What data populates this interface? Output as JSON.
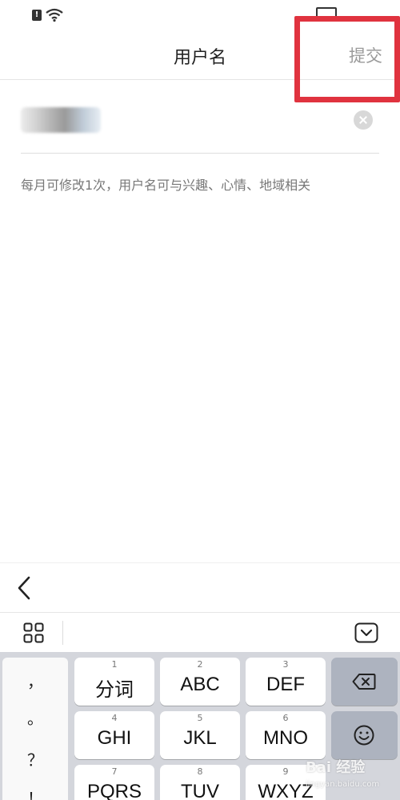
{
  "status_bar": {
    "sim_alert": "!",
    "battery": "",
    "time": ""
  },
  "nav": {
    "title": "用户名",
    "submit_label": "提交"
  },
  "form": {
    "username_value": "",
    "hint": "每月可修改1次，用户名可与兴趣、心情、地域相关"
  },
  "keyboard": {
    "punctuation": [
      "，",
      "。",
      "？",
      "！"
    ],
    "keys": [
      {
        "num": "1",
        "label": "分词"
      },
      {
        "num": "2",
        "label": "ABC"
      },
      {
        "num": "3",
        "label": "DEF"
      },
      {
        "num": "4",
        "label": "GHI"
      },
      {
        "num": "5",
        "label": "JKL"
      },
      {
        "num": "6",
        "label": "MNO"
      },
      {
        "num": "7",
        "label": "PQRS"
      },
      {
        "num": "8",
        "label": "TUV"
      },
      {
        "num": "9",
        "label": "WXYZ"
      }
    ]
  },
  "watermark": {
    "text": "Bai 经验",
    "sub": "jingyan.baidu.com"
  },
  "colors": {
    "highlight": "#e0333f",
    "submit_text": "#9a9a9a",
    "keyboard_bg": "#d4d6dc",
    "function_key": "#adb3bf"
  }
}
